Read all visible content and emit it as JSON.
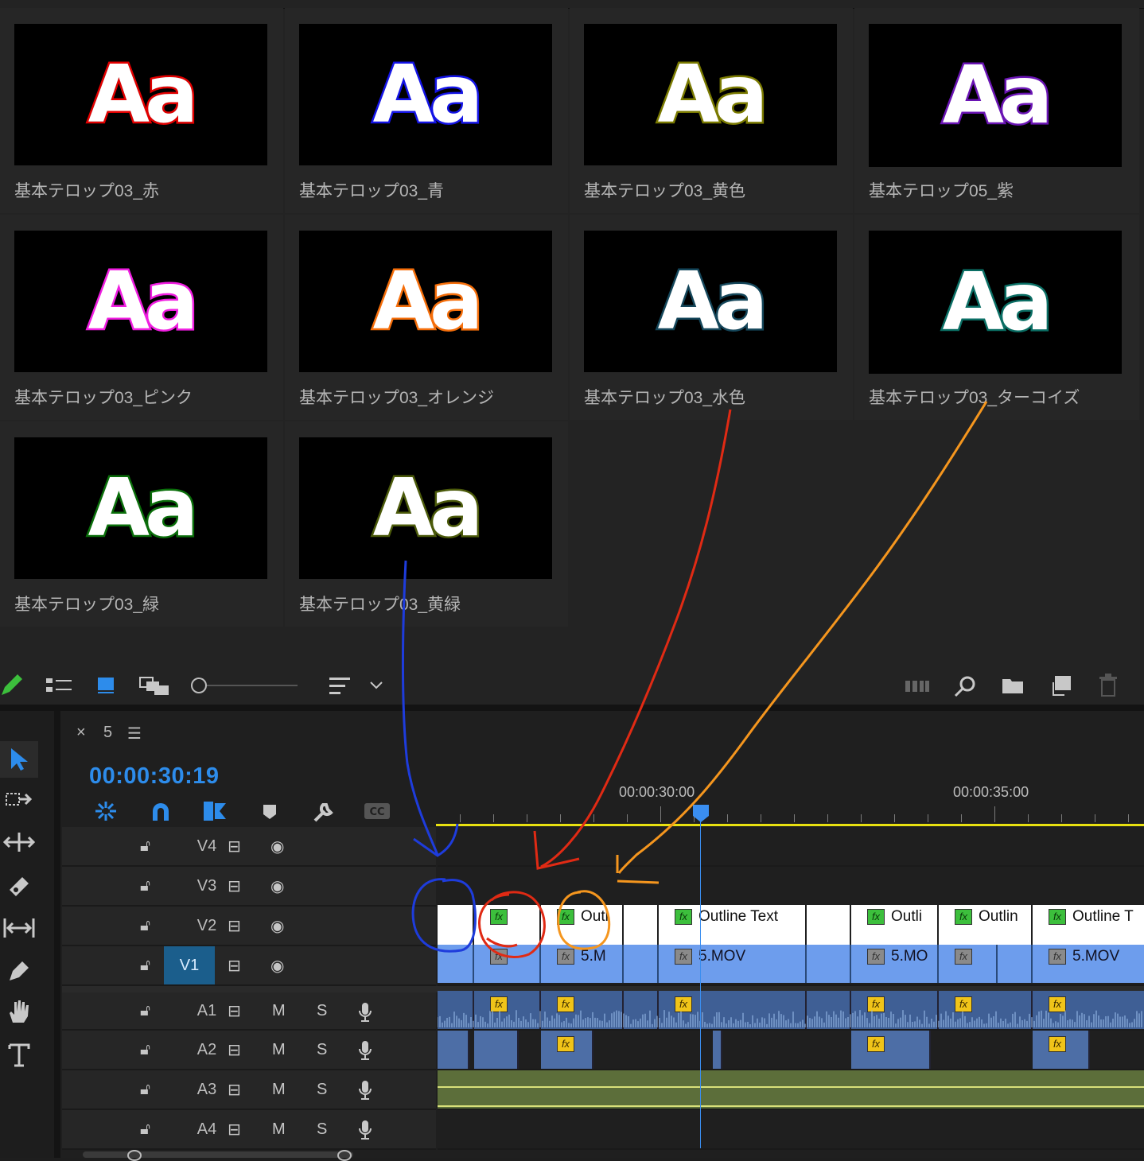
{
  "bin": {
    "items": [
      {
        "name": "基本テロップ03_赤",
        "preview": "Aa",
        "outline": "#e30000",
        "fill": "#ffffff"
      },
      {
        "name": "基本テロップ03_青",
        "preview": "Aa",
        "outline": "#1414e6",
        "fill": "#ffffff"
      },
      {
        "name": "基本テロップ03_黄色",
        "preview": "Aa",
        "outline": "#7a7a00",
        "fill": "#ffffff"
      },
      {
        "name": "基本テロップ05_紫",
        "preview": "Aa",
        "outline": "#6a14b4",
        "fill": "#ffffff"
      },
      {
        "name": "基本テロップ03_ピンク",
        "preview": "Aa",
        "outline": "#f01ee1",
        "fill": "#ffffff"
      },
      {
        "name": "基本テロップ03_オレンジ",
        "preview": "Aa",
        "outline": "#f56e0a",
        "fill": "#ffffff"
      },
      {
        "name": "基本テロップ03_水色",
        "preview": "Aa",
        "outline": "#14465a",
        "fill": "#ffffff"
      },
      {
        "name": "基本テロップ03_ターコイズ",
        "preview": "Aa",
        "outline": "#0a6e64",
        "fill": "#ffffff"
      },
      {
        "name": "基本テロップ03_緑",
        "preview": "Aa",
        "outline": "#0a6e0a",
        "fill": "#ffffff"
      },
      {
        "name": "基本テロップ03_黄緑",
        "preview": "Aa",
        "outline": "#4b5a0a",
        "fill": "#ffffff"
      }
    ]
  },
  "toolbar": {
    "icons": [
      "pencil-icon",
      "list-view-icon",
      "icon-view-icon",
      "freeform-view-icon",
      "zoom-slider",
      "sort-icon",
      "chevron-down-icon",
      "automate-to-sequence-icon",
      "find-icon",
      "new-bin-icon",
      "new-item-icon",
      "clear-icon"
    ]
  },
  "sequence": {
    "close": "×",
    "name": "5",
    "menu": "☰",
    "timecode": "00:00:30:19",
    "ruler": {
      "marks": [
        "00:00:30:00",
        "00:00:35:00"
      ]
    }
  },
  "tools": [
    "selection-tool",
    "track-select-tool",
    "ripple-edit-tool",
    "razor-tool",
    "slip-tool",
    "pen-tool",
    "hand-tool",
    "type-tool"
  ],
  "tracks": {
    "video": [
      {
        "name": "V4",
        "selected": false
      },
      {
        "name": "V3",
        "selected": false
      },
      {
        "name": "V2",
        "selected": false
      },
      {
        "name": "V1",
        "selected": true
      }
    ],
    "audio": [
      {
        "name": "A1",
        "m": "M",
        "s": "S"
      },
      {
        "name": "A2",
        "m": "M",
        "s": "S"
      },
      {
        "name": "A3",
        "m": "M",
        "s": "S"
      },
      {
        "name": "A4",
        "m": "M",
        "s": "S"
      }
    ]
  },
  "clips": {
    "v2": [
      "",
      "Outl",
      "Outline Text",
      "Outli",
      "Outlin",
      "Outline T"
    ],
    "v1": [
      "5.M",
      "5.MOV",
      "5.MO",
      "5.MOV"
    ]
  },
  "colors": {
    "timecode": "#2d8ceb",
    "work_area": "#e8e010",
    "playhead": "#3a8ef0",
    "annotation_blue": "#1e3cdc",
    "annotation_red": "#e02a14",
    "annotation_orange": "#f5961e"
  }
}
